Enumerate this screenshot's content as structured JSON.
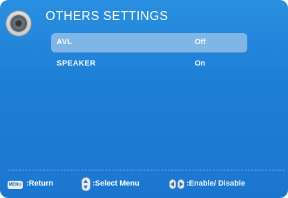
{
  "header": {
    "title": "OTHERS SETTINGS",
    "icon": "speaker-icon"
  },
  "menu": {
    "items": [
      {
        "label": "AVL",
        "value": "Off",
        "selected": true
      },
      {
        "label": "SPEAKER",
        "value": "On",
        "selected": false
      }
    ]
  },
  "footer": {
    "menu_key_label": "MENU",
    "return_text": ":Return",
    "select_text": ":Select Menu",
    "enable_text": ":Enable/ Disable"
  },
  "colors": {
    "background": "#1e7fd6",
    "highlight": "#7fb6e6",
    "text": "#ffffff"
  }
}
